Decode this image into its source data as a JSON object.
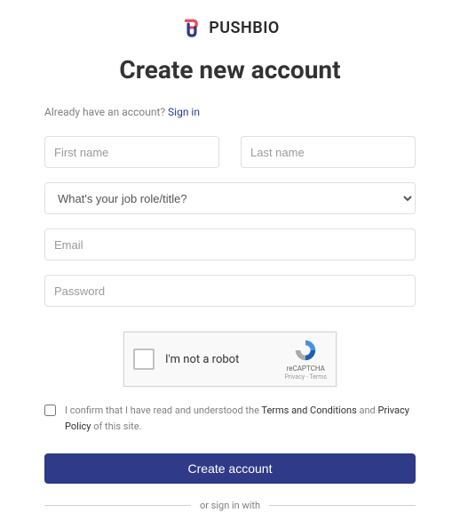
{
  "brand": {
    "name": "PUSHBIO"
  },
  "title": "Create new account",
  "signin": {
    "prompt": "Already have an account? ",
    "link_text": "Sign in"
  },
  "fields": {
    "first_name_placeholder": "First name",
    "last_name_placeholder": "Last name",
    "job_role_placeholder": "What's your job role/title?",
    "email_placeholder": "Email",
    "password_placeholder": "Password"
  },
  "recaptcha": {
    "label": "I'm not a robot",
    "brand": "reCAPTCHA",
    "terms": "Privacy - Terms"
  },
  "consent": {
    "prefix": "I confirm that I have read and understood the ",
    "terms_label": "Terms and Conditions",
    "and": " and ",
    "privacy_label": "Privacy Policy",
    "suffix": " of this site."
  },
  "submit_label": "Create account",
  "divider_text": "or sign in with"
}
